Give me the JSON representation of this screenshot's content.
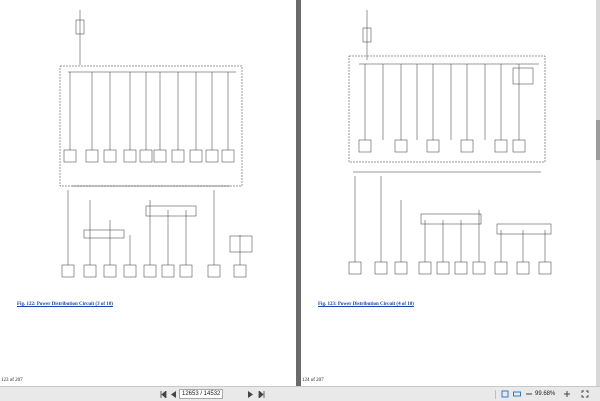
{
  "left_page": {
    "caption": "Fig. 122: Power Distribution Circuit (3 of 10)",
    "page_label": "123 of 207"
  },
  "right_page": {
    "caption": "Fig. 123: Power Distribution Circuit (4 of 10)",
    "page_label": "124 of 207"
  },
  "toolbar": {
    "first_icon": "first-page-icon",
    "prev_icon": "previous-page-icon",
    "page_input_value": "12653 / 14532",
    "next_icon": "next-page-icon",
    "last_icon": "last-page-icon",
    "zoom_value": "99.68%"
  }
}
